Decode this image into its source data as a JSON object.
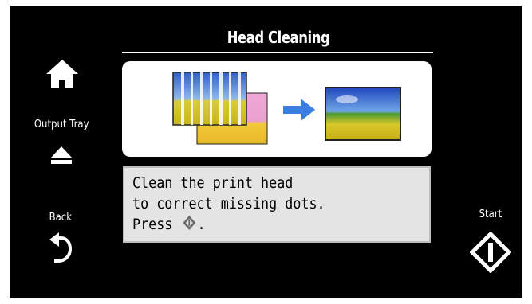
{
  "screen": {
    "title": "Head Cleaning"
  },
  "left_panel": {
    "home": {
      "icon": "home-icon"
    },
    "output_tray": {
      "label": "Output Tray",
      "icon": "eject-icon"
    },
    "back": {
      "label": "Back",
      "icon": "back-arrow-icon"
    }
  },
  "right_panel": {
    "start": {
      "label": "Start",
      "icon": "start-diamond-icon"
    }
  },
  "illustration": {
    "before_icon": "streaked-print-icon",
    "arrow_icon": "right-arrow-icon",
    "after_icon": "clean-print-icon"
  },
  "message": {
    "line1": "Clean the print head",
    "line2": "to correct missing dots.",
    "line3_prefix": "Press",
    "line3_suffix": ".",
    "inline_icon": "start-diamond-icon"
  },
  "colors": {
    "background": "#000000",
    "message_box": "#e4e4e4",
    "arrow": "#3b7de0"
  }
}
